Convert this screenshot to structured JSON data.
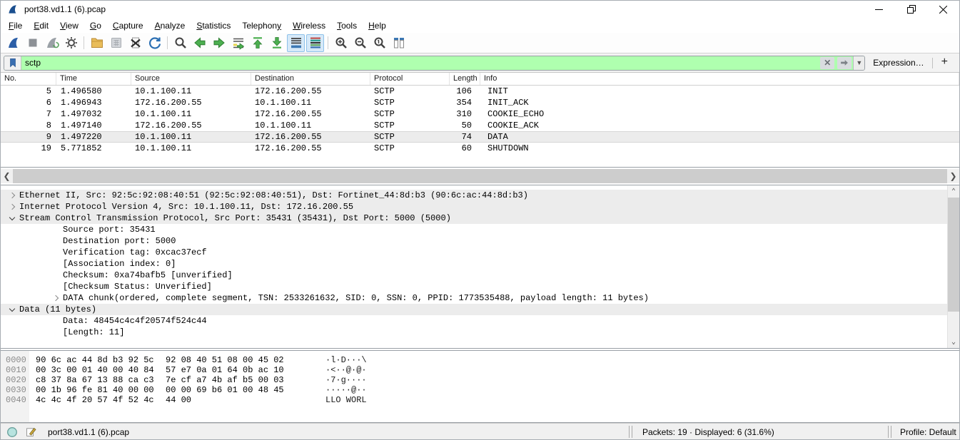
{
  "window": {
    "title": "port38.vd1.1 (6).pcap",
    "controls": [
      "minimize",
      "restore-down",
      "close"
    ]
  },
  "menu": {
    "items": [
      {
        "label": "File",
        "mnemonic_index": 0
      },
      {
        "label": "Edit",
        "mnemonic_index": 0
      },
      {
        "label": "View",
        "mnemonic_index": 0
      },
      {
        "label": "Go",
        "mnemonic_index": 0
      },
      {
        "label": "Capture",
        "mnemonic_index": 0
      },
      {
        "label": "Analyze",
        "mnemonic_index": 0
      },
      {
        "label": "Statistics",
        "mnemonic_index": 0
      },
      {
        "label": "Telephony",
        "mnemonic_index": 8
      },
      {
        "label": "Wireless",
        "mnemonic_index": 0
      },
      {
        "label": "Tools",
        "mnemonic_index": 0
      },
      {
        "label": "Help",
        "mnemonic_index": 0
      }
    ]
  },
  "toolbar": {
    "items": [
      {
        "name": "start-capture",
        "icon": "wireshark-fin-blue"
      },
      {
        "name": "stop-capture",
        "icon": "stop-square",
        "disabled": true
      },
      {
        "name": "restart-capture",
        "icon": "wireshark-fin-gray",
        "disabled": true
      },
      {
        "name": "capture-options",
        "icon": "gear"
      },
      {
        "type": "separator"
      },
      {
        "name": "open-file",
        "icon": "folder-open"
      },
      {
        "name": "save-file",
        "icon": "save-grid",
        "disabled": true
      },
      {
        "name": "close-file",
        "icon": "close-document"
      },
      {
        "name": "reload-file",
        "icon": "reload-arrow"
      },
      {
        "type": "separator"
      },
      {
        "name": "find-packet",
        "icon": "magnifier"
      },
      {
        "name": "go-back",
        "icon": "arrow-left-green"
      },
      {
        "name": "go-forward",
        "icon": "arrow-right-green"
      },
      {
        "name": "go-to-packet",
        "icon": "goto-packet"
      },
      {
        "name": "go-to-first",
        "icon": "arrow-top-green"
      },
      {
        "name": "go-to-last",
        "icon": "arrow-bottom-green"
      },
      {
        "name": "auto-scroll-toggle",
        "icon": "auto-scroll",
        "active": true
      },
      {
        "name": "colorize-toggle",
        "icon": "colorize-lines",
        "active": true
      },
      {
        "type": "separator"
      },
      {
        "name": "zoom-in",
        "icon": "magnifier-plus"
      },
      {
        "name": "zoom-out",
        "icon": "magnifier-minus"
      },
      {
        "name": "zoom-original",
        "icon": "magnifier-one"
      },
      {
        "name": "resize-columns",
        "icon": "resize-columns"
      }
    ]
  },
  "filter": {
    "value": "sctp",
    "valid_background": "#afffaf",
    "bookmark_icon": "bookmark-icon",
    "clear_icon": "clear-filter-icon",
    "apply_icon": "apply-filter-icon",
    "dropdown_icon": "chevron-down-icon",
    "expression_label": "Expression…",
    "add_label": "+"
  },
  "packet_list": {
    "columns": [
      "No.",
      "Time",
      "Source",
      "Destination",
      "Protocol",
      "Length",
      "Info"
    ],
    "rows": [
      {
        "no": "5",
        "time": "1.496580",
        "source": "10.1.100.11",
        "destination": "172.16.200.55",
        "protocol": "SCTP",
        "length": "106",
        "info": "INIT"
      },
      {
        "no": "6",
        "time": "1.496943",
        "source": "172.16.200.55",
        "destination": "10.1.100.11",
        "protocol": "SCTP",
        "length": "354",
        "info": "INIT_ACK"
      },
      {
        "no": "7",
        "time": "1.497032",
        "source": "10.1.100.11",
        "destination": "172.16.200.55",
        "protocol": "SCTP",
        "length": "310",
        "info": "COOKIE_ECHO"
      },
      {
        "no": "8",
        "time": "1.497140",
        "source": "172.16.200.55",
        "destination": "10.1.100.11",
        "protocol": "SCTP",
        "length": "50",
        "info": "COOKIE_ACK"
      },
      {
        "no": "9",
        "time": "1.497220",
        "source": "10.1.100.11",
        "destination": "172.16.200.55",
        "protocol": "SCTP",
        "length": "74",
        "info": "DATA",
        "selected": true
      },
      {
        "no": "19",
        "time": "5.771852",
        "source": "10.1.100.11",
        "destination": "172.16.200.55",
        "protocol": "SCTP",
        "length": "60",
        "info": "SHUTDOWN"
      }
    ]
  },
  "details": {
    "rows": [
      {
        "level": 0,
        "expander": "collapsed",
        "text": "Ethernet II, Src: 92:5c:92:08:40:51 (92:5c:92:08:40:51), Dst: Fortinet_44:8d:b3 (90:6c:ac:44:8d:b3)"
      },
      {
        "level": 0,
        "expander": "collapsed",
        "text": "Internet Protocol Version 4, Src: 10.1.100.11, Dst: 172.16.200.55"
      },
      {
        "level": 0,
        "expander": "expanded",
        "text": "Stream Control Transmission Protocol, Src Port: 35431 (35431), Dst Port: 5000 (5000)"
      },
      {
        "level": 1,
        "expander": null,
        "text": "Source port: 35431"
      },
      {
        "level": 1,
        "expander": null,
        "text": "Destination port: 5000"
      },
      {
        "level": 1,
        "expander": null,
        "text": "Verification tag: 0xcac37ecf"
      },
      {
        "level": 1,
        "expander": null,
        "text": "[Association index: 0]"
      },
      {
        "level": 1,
        "expander": null,
        "text": "Checksum: 0xa74bafb5 [unverified]"
      },
      {
        "level": 1,
        "expander": null,
        "text": "[Checksum Status: Unverified]"
      },
      {
        "level": 1,
        "expander": "collapsed",
        "text": "DATA chunk(ordered, complete segment, TSN: 2533261632, SID: 0, SSN: 0, PPID: 1773535488, payload length: 11 bytes)"
      },
      {
        "level": 0,
        "expander": "expanded",
        "text": "Data (11 bytes)"
      },
      {
        "level": 1,
        "expander": null,
        "text": "Data: 48454c4c4f20574f524c44"
      },
      {
        "level": 1,
        "expander": null,
        "text": "[Length: 11]"
      }
    ]
  },
  "hex": {
    "rows": [
      {
        "offset": "0000",
        "hex1": "90 6c ac 44 8d b3 92 5c",
        "hex2": "92 08 40 51 08 00 45 02",
        "ascii": "·l·D···\\"
      },
      {
        "offset": "0010",
        "hex1": "00 3c 00 01 40 00 40 84",
        "hex2": "57 e7 0a 01 64 0b ac 10",
        "ascii": "·<··@·@·"
      },
      {
        "offset": "0020",
        "hex1": "c8 37 8a 67 13 88 ca c3",
        "hex2": "7e cf a7 4b af b5 00 03",
        "ascii": "·7·g····"
      },
      {
        "offset": "0030",
        "hex1": "00 1b 96 fe 81 40 00 00",
        "hex2": "00 00 69 b6 01 00 48 45",
        "ascii": "·····@··"
      },
      {
        "offset": "0040",
        "hex1": "4c 4c 4f 20 57 4f 52 4c",
        "hex2": "44 00",
        "ascii": "LLO WORL"
      }
    ]
  },
  "status": {
    "filename": "port38.vd1.1 (6).pcap",
    "packets": "Packets: 19 · Displayed: 6 (31.6%)",
    "profile": "Profile: Default",
    "icons": [
      "expert-info",
      "capture-comment"
    ]
  }
}
